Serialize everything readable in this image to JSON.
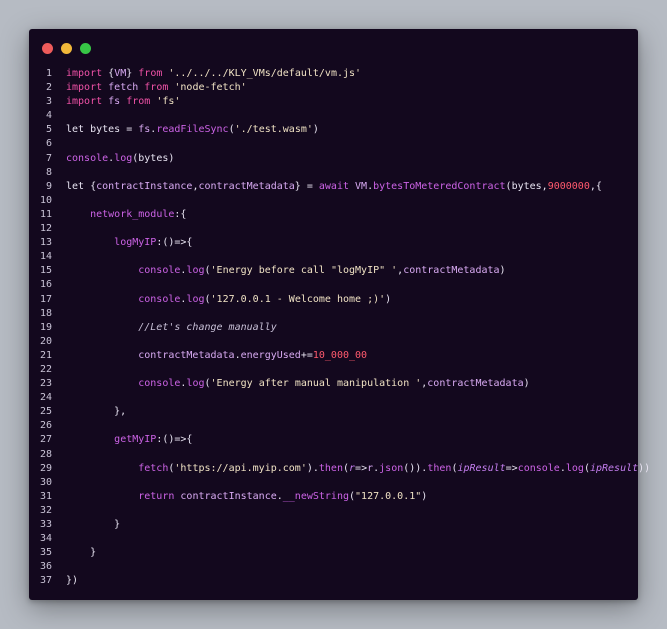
{
  "window": {
    "controls": [
      {
        "name": "close",
        "color": "#ee5b5b"
      },
      {
        "name": "minimize",
        "color": "#f1b83a"
      },
      {
        "name": "maximize",
        "color": "#37c646"
      }
    ]
  },
  "code": {
    "lines": [
      {
        "n": "1",
        "tokens": [
          [
            "kw",
            "import "
          ],
          [
            "pl",
            "{"
          ],
          [
            "var",
            "VM"
          ],
          [
            "pl",
            "} "
          ],
          [
            "kw",
            "from "
          ],
          [
            "str",
            "'../../../KLY_VMs/default/vm.js'"
          ]
        ]
      },
      {
        "n": "2",
        "tokens": [
          [
            "kw",
            "import "
          ],
          [
            "var",
            "fetch "
          ],
          [
            "kw",
            "from "
          ],
          [
            "str",
            "'node-fetch'"
          ]
        ]
      },
      {
        "n": "3",
        "tokens": [
          [
            "kw",
            "import "
          ],
          [
            "var",
            "fs "
          ],
          [
            "kw",
            "from "
          ],
          [
            "str",
            "'fs'"
          ]
        ]
      },
      {
        "n": "4",
        "tokens": []
      },
      {
        "n": "5",
        "tokens": [
          [
            "pl",
            "let bytes = "
          ],
          [
            "var",
            "fs"
          ],
          [
            "pl",
            "."
          ],
          [
            "fn",
            "readFileSync"
          ],
          [
            "pl",
            "("
          ],
          [
            "str",
            "'./test.wasm'"
          ],
          [
            "pl",
            ")"
          ]
        ]
      },
      {
        "n": "6",
        "tokens": []
      },
      {
        "n": "7",
        "tokens": [
          [
            "fn",
            "console"
          ],
          [
            "pl",
            "."
          ],
          [
            "fn",
            "log"
          ],
          [
            "pl",
            "(bytes)"
          ]
        ]
      },
      {
        "n": "8",
        "tokens": []
      },
      {
        "n": "9",
        "tokens": [
          [
            "pl",
            "let {"
          ],
          [
            "var",
            "contractInstance"
          ],
          [
            "pl",
            ","
          ],
          [
            "var",
            "contractMetadata"
          ],
          [
            "pl",
            "} = "
          ],
          [
            "kw2",
            "await "
          ],
          [
            "var",
            "VM"
          ],
          [
            "pl",
            "."
          ],
          [
            "fn",
            "bytesToMeteredContract"
          ],
          [
            "pl",
            "(bytes,"
          ],
          [
            "num",
            "9000000"
          ],
          [
            "pl",
            ",{"
          ]
        ]
      },
      {
        "n": "10",
        "tokens": []
      },
      {
        "n": "11",
        "tokens": [
          [
            "pl",
            "    "
          ],
          [
            "fn",
            "network_module"
          ],
          [
            "pl",
            ":{"
          ]
        ]
      },
      {
        "n": "12",
        "tokens": []
      },
      {
        "n": "13",
        "tokens": [
          [
            "pl",
            "        "
          ],
          [
            "fn",
            "logMyIP"
          ],
          [
            "pl",
            ":()=>{"
          ]
        ]
      },
      {
        "n": "14",
        "tokens": []
      },
      {
        "n": "15",
        "tokens": [
          [
            "pl",
            "            "
          ],
          [
            "fn",
            "console"
          ],
          [
            "pl",
            "."
          ],
          [
            "fn",
            "log"
          ],
          [
            "pl",
            "("
          ],
          [
            "str",
            "'Energy before call \"logMyIP\" '"
          ],
          [
            "pl",
            ","
          ],
          [
            "var",
            "contractMetadata"
          ],
          [
            "pl",
            ")"
          ]
        ]
      },
      {
        "n": "16",
        "tokens": []
      },
      {
        "n": "17",
        "tokens": [
          [
            "pl",
            "            "
          ],
          [
            "fn",
            "console"
          ],
          [
            "pl",
            "."
          ],
          [
            "fn",
            "log"
          ],
          [
            "pl",
            "("
          ],
          [
            "str",
            "'127.0.0.1 - Welcome home ;)'"
          ],
          [
            "pl",
            ")"
          ]
        ]
      },
      {
        "n": "18",
        "tokens": []
      },
      {
        "n": "19",
        "tokens": [
          [
            "pl",
            "            "
          ],
          [
            "cm",
            "//Let's change manually"
          ]
        ]
      },
      {
        "n": "20",
        "tokens": []
      },
      {
        "n": "21",
        "tokens": [
          [
            "pl",
            "            "
          ],
          [
            "var",
            "contractMetadata"
          ],
          [
            "pl",
            "."
          ],
          [
            "var",
            "energyUsed"
          ],
          [
            "pl",
            "+="
          ],
          [
            "num",
            "10_000_00"
          ]
        ]
      },
      {
        "n": "22",
        "tokens": []
      },
      {
        "n": "23",
        "tokens": [
          [
            "pl",
            "            "
          ],
          [
            "fn",
            "console"
          ],
          [
            "pl",
            "."
          ],
          [
            "fn",
            "log"
          ],
          [
            "pl",
            "("
          ],
          [
            "str",
            "'Energy after manual manipulation '"
          ],
          [
            "pl",
            ","
          ],
          [
            "var",
            "contractMetadata"
          ],
          [
            "pl",
            ")"
          ]
        ]
      },
      {
        "n": "24",
        "tokens": []
      },
      {
        "n": "25",
        "tokens": [
          [
            "pl",
            "        },"
          ]
        ]
      },
      {
        "n": "26",
        "tokens": []
      },
      {
        "n": "27",
        "tokens": [
          [
            "pl",
            "        "
          ],
          [
            "fn",
            "getMyIP"
          ],
          [
            "pl",
            ":()=>{"
          ]
        ]
      },
      {
        "n": "28",
        "tokens": []
      },
      {
        "n": "29",
        "tokens": [
          [
            "pl",
            "            "
          ],
          [
            "fn",
            "fetch"
          ],
          [
            "pl",
            "("
          ],
          [
            "str",
            "'https://api.myip.com'"
          ],
          [
            "pl",
            ")."
          ],
          [
            "fn",
            "then"
          ],
          [
            "pl",
            "("
          ],
          [
            "it",
            "r"
          ],
          [
            "pl",
            "=>"
          ],
          [
            "var",
            "r"
          ],
          [
            "pl",
            "."
          ],
          [
            "fn",
            "json"
          ],
          [
            "pl",
            "())."
          ],
          [
            "fn",
            "then"
          ],
          [
            "pl",
            "("
          ],
          [
            "it",
            "ipResult"
          ],
          [
            "pl",
            "=>"
          ],
          [
            "fn",
            "console"
          ],
          [
            "pl",
            "."
          ],
          [
            "fn",
            "log"
          ],
          [
            "pl",
            "("
          ],
          [
            "it",
            "ipResult"
          ],
          [
            "pl",
            "))"
          ]
        ]
      },
      {
        "n": "30",
        "tokens": []
      },
      {
        "n": "31",
        "tokens": [
          [
            "pl",
            "            "
          ],
          [
            "kw2",
            "return "
          ],
          [
            "var",
            "contractInstance"
          ],
          [
            "pl",
            "."
          ],
          [
            "fn",
            "__newString"
          ],
          [
            "pl",
            "("
          ],
          [
            "str",
            "\"127.0.0.1\""
          ],
          [
            "pl",
            ")"
          ]
        ]
      },
      {
        "n": "32",
        "tokens": []
      },
      {
        "n": "33",
        "tokens": [
          [
            "pl",
            "        }"
          ]
        ]
      },
      {
        "n": "34",
        "tokens": []
      },
      {
        "n": "35",
        "tokens": [
          [
            "pl",
            "    }"
          ]
        ]
      },
      {
        "n": "36",
        "tokens": []
      },
      {
        "n": "37",
        "tokens": [
          [
            "pl",
            "})"
          ]
        ]
      }
    ]
  }
}
